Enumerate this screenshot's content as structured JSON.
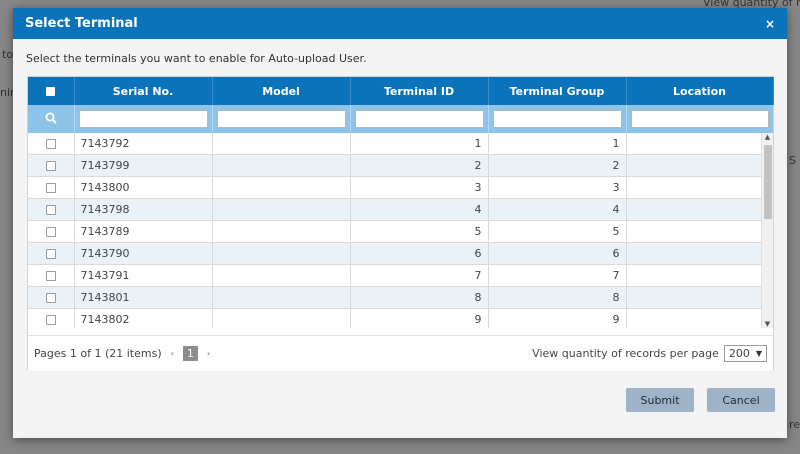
{
  "background": {
    "frag_top_right": "View quantity of re",
    "frag_left_to": "to",
    "frag_left_nin": "nin",
    "frag_right_s": "S",
    "frag_bottom_right": "re"
  },
  "modal": {
    "title": "Select Terminal",
    "close_icon": "×",
    "instructions": "Select the terminals you want to enable for Auto-upload User."
  },
  "table": {
    "columns": [
      "Serial No.",
      "Model",
      "Terminal ID",
      "Terminal Group",
      "Location"
    ],
    "search_icon": "search-icon",
    "filters": [
      "",
      "",
      "",
      "",
      ""
    ],
    "rows": [
      {
        "serial": "7143792",
        "model": "",
        "terminal_id": "1",
        "group": "1",
        "location": ""
      },
      {
        "serial": "7143799",
        "model": "",
        "terminal_id": "2",
        "group": "2",
        "location": ""
      },
      {
        "serial": "7143800",
        "model": "",
        "terminal_id": "3",
        "group": "3",
        "location": ""
      },
      {
        "serial": "7143798",
        "model": "",
        "terminal_id": "4",
        "group": "4",
        "location": ""
      },
      {
        "serial": "7143789",
        "model": "",
        "terminal_id": "5",
        "group": "5",
        "location": ""
      },
      {
        "serial": "7143790",
        "model": "",
        "terminal_id": "6",
        "group": "6",
        "location": ""
      },
      {
        "serial": "7143791",
        "model": "",
        "terminal_id": "7",
        "group": "7",
        "location": ""
      },
      {
        "serial": "7143801",
        "model": "",
        "terminal_id": "8",
        "group": "8",
        "location": ""
      },
      {
        "serial": "7143802",
        "model": "",
        "terminal_id": "9",
        "group": "9",
        "location": ""
      },
      {
        "serial": "",
        "model": "",
        "terminal_id": "",
        "group": "",
        "location": ""
      }
    ]
  },
  "pager": {
    "info": "Pages 1 of 1 (21 items)",
    "prev_icon": "‹",
    "current_page": "1",
    "next_icon": "›",
    "records_label": "View quantity of records per page",
    "records_value": "200",
    "records_caret": "▼"
  },
  "buttons": {
    "submit": "Submit",
    "cancel": "Cancel"
  },
  "colors": {
    "header_blue": "#0a73b9",
    "filter_blue": "#8ec3ea",
    "row_alt": "#eaf1f7",
    "button": "#9eb3c8"
  }
}
